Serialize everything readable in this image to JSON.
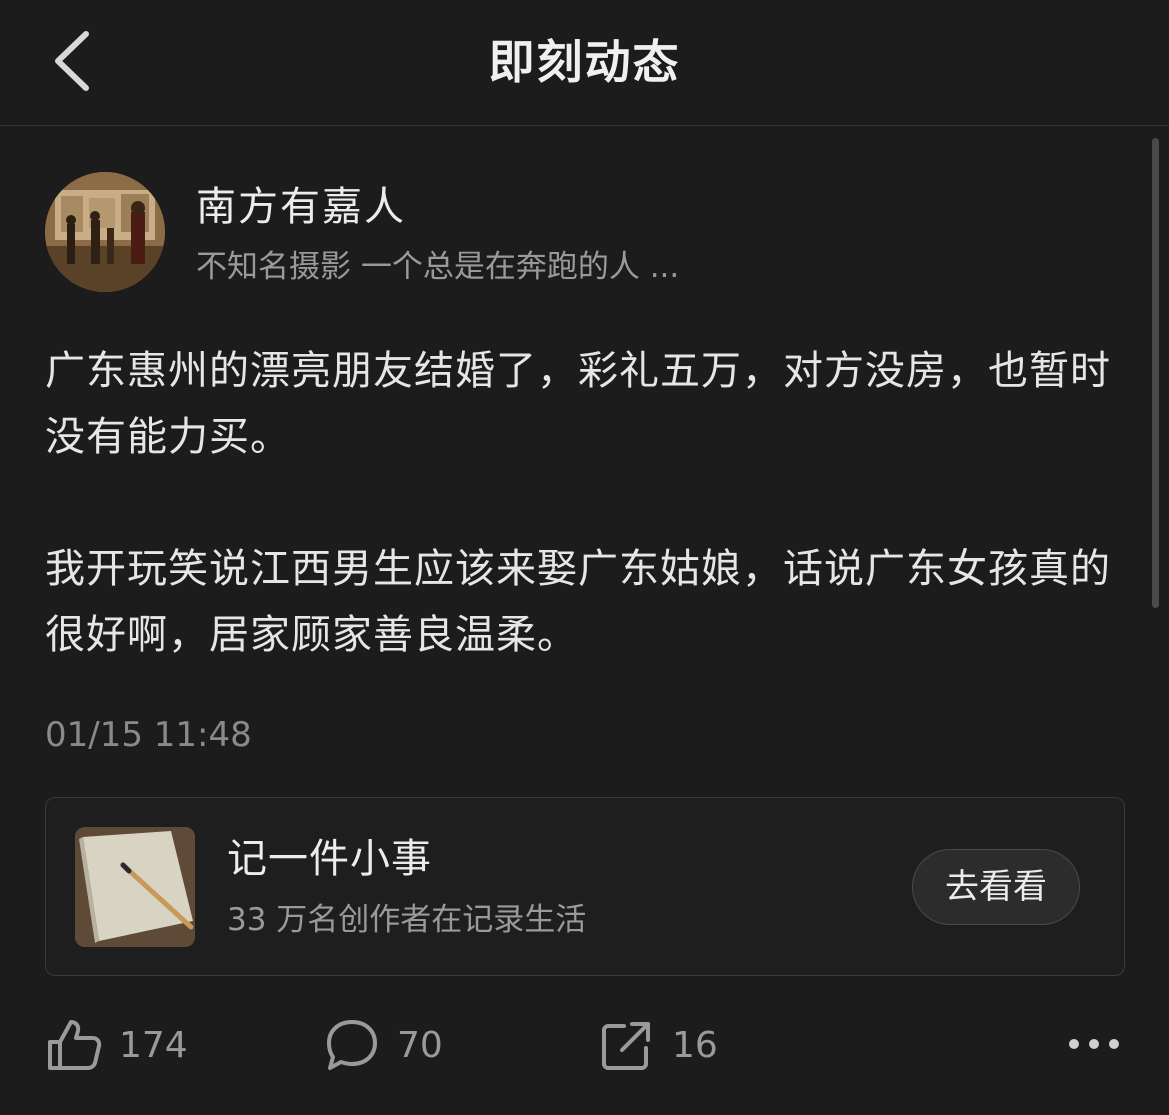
{
  "header": {
    "title": "即刻动态",
    "back_icon": "chevron-left-icon"
  },
  "author": {
    "name": "南方有嘉人",
    "bio": "不知名摄影  一个总是在奔跑的人 ..."
  },
  "post": {
    "paragraphs": [
      "广东惠州的漂亮朋友结婚了，彩礼五万，对方没房，也暂时没有能力买。",
      "我开玩笑说江西男生应该来娶广东姑娘，话说广东女孩真的很好啊，居家顾家善良温柔。"
    ],
    "timestamp": "01/15 11:48"
  },
  "promo": {
    "title": "记一件小事",
    "subtitle": "33 万名创作者在记录生活",
    "button_label": "去看看"
  },
  "actions": {
    "likes": "174",
    "comments": "70",
    "shares": "16",
    "like_icon": "thumbs-up-icon",
    "comment_icon": "comment-bubble-icon",
    "share_icon": "share-icon",
    "more_icon": "more-dots-icon"
  },
  "colors": {
    "background": "#1c1c1c",
    "text_primary": "#e6e6e6",
    "text_secondary": "#9a9a9a",
    "border": "#3a3a3a"
  }
}
